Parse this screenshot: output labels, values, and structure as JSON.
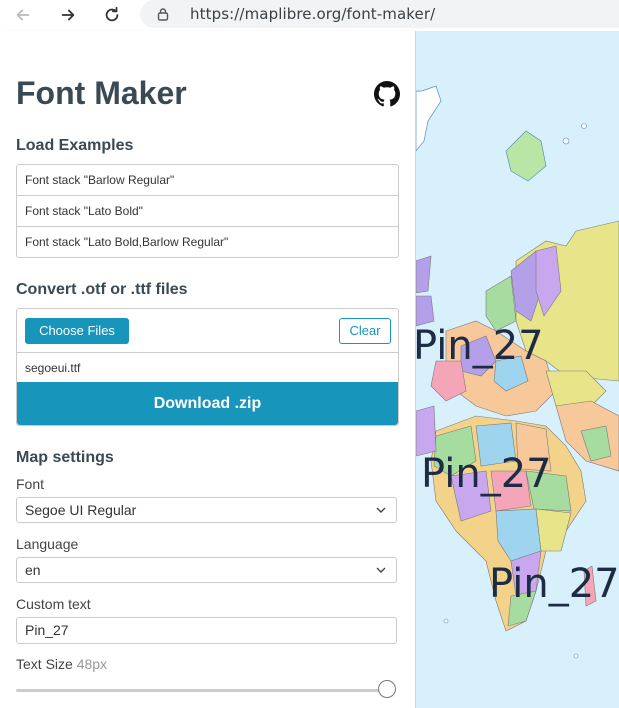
{
  "browser": {
    "url": "https://maplibre.org/font-maker/"
  },
  "header": {
    "title": "Font Maker"
  },
  "load_examples": {
    "heading": "Load Examples",
    "items": [
      "Font stack \"Barlow Regular\"",
      "Font stack \"Lato Bold\"",
      "Font stack \"Lato Bold,Barlow Regular\""
    ]
  },
  "convert": {
    "heading": "Convert .otf or .ttf files",
    "choose_label": "Choose Files",
    "clear_label": "Clear",
    "file_name": "segoeui.ttf",
    "download_label": "Download .zip"
  },
  "map_settings": {
    "heading": "Map settings",
    "font_label": "Font",
    "font_value": "Segoe UI Regular",
    "language_label": "Language",
    "language_value": "en",
    "custom_text_label": "Custom text",
    "custom_text_value": "Pin_27",
    "text_size_label": "Text Size",
    "text_size_value": "48px",
    "text_size_slider_level": 1.0
  },
  "map": {
    "pin_labels": [
      "Pin_27",
      "Pin_27",
      "Pin_27"
    ]
  },
  "colors": {
    "accent": "#1795bb",
    "title": "#3a4a54",
    "ocean": "#d8f0fb"
  }
}
